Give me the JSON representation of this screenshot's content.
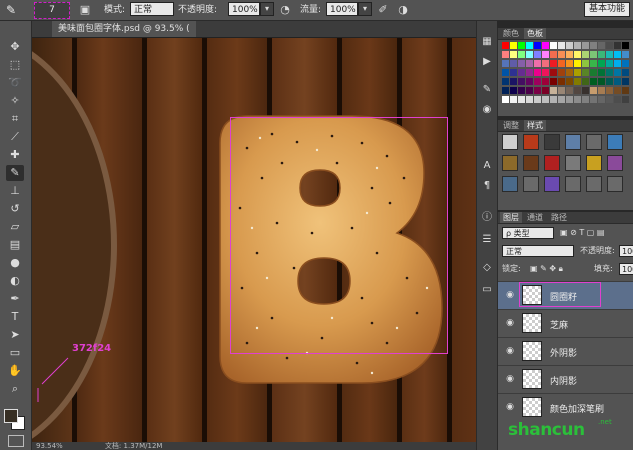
{
  "options_bar": {
    "brush_size": "7",
    "mode_label": "模式:",
    "mode_value": "正常",
    "opacity_label": "不透明度:",
    "opacity_value": "100%",
    "flow_label": "流量:",
    "flow_value": "100%",
    "workspace": "基本功能"
  },
  "document": {
    "tab_title": "美味面包圈字体.psd @ 93.5% (",
    "annotation": "372f24",
    "status_zoom": "93.54%",
    "status_doc": "文档: 1.37M/12M"
  },
  "colors": {
    "foreground": "#372f24",
    "annotation": "#e040d0",
    "wood": "#5a2e12",
    "bread": "#d8a25a"
  },
  "swatches_panel": {
    "tabs": [
      "颜色",
      "色板"
    ],
    "active": "色板"
  },
  "styles_panel": {
    "tabs": [
      "调整",
      "样式"
    ],
    "active": "样式"
  },
  "layers_panel": {
    "tabs": [
      "图层",
      "通道",
      "路径"
    ],
    "active": "图层",
    "filter_label": "类型",
    "blend_mode": "正常",
    "opacity_label": "不透明度:",
    "opacity_value": "100",
    "lock_label": "锁定:",
    "fill_label": "填充:",
    "fill_value": "100",
    "layers": [
      {
        "name": "圆圈籽",
        "selected": true
      },
      {
        "name": "芝麻",
        "selected": false
      },
      {
        "name": "外阴影",
        "selected": false
      },
      {
        "name": "内阴影",
        "selected": false
      },
      {
        "name": "颜色加深笔刷",
        "selected": false
      }
    ]
  },
  "watermark": {
    "text": "shancun",
    "sub": ".net"
  }
}
